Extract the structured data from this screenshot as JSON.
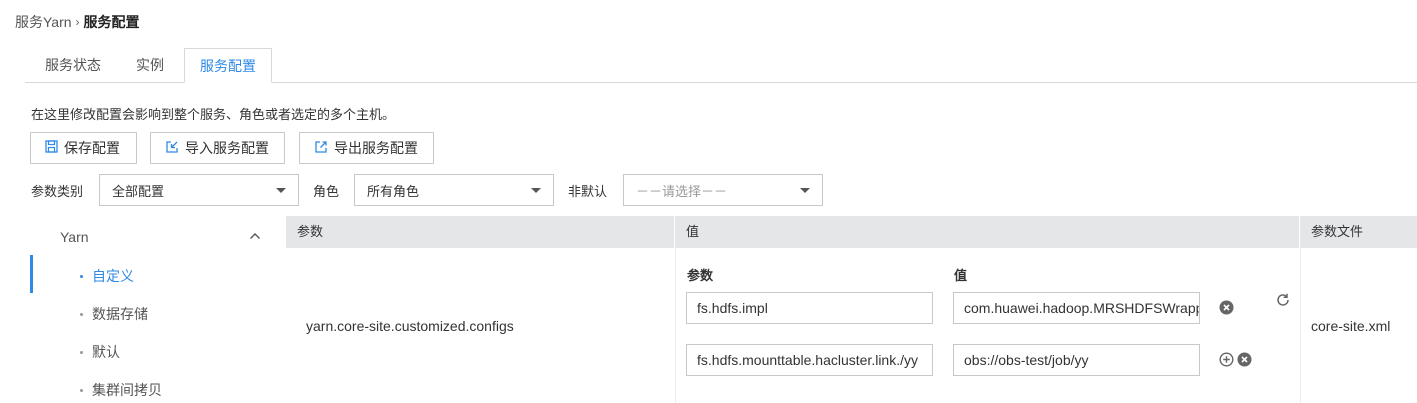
{
  "breadcrumb": {
    "parent": "服务Yarn",
    "separator": "›",
    "current": "服务配置"
  },
  "tabs": [
    {
      "label": "服务状态",
      "active": false
    },
    {
      "label": "实例",
      "active": false
    },
    {
      "label": "服务配置",
      "active": true
    }
  ],
  "description": "在这里修改配置会影响到整个服务、角色或者选定的多个主机。",
  "toolbar": {
    "save_label": "保存配置",
    "import_label": "导入服务配置",
    "export_label": "导出服务配置"
  },
  "filters": {
    "category_label": "参数类别",
    "category_value": "全部配置",
    "role_label": "角色",
    "role_value": "所有角色",
    "nondefault_label": "非默认",
    "nondefault_placeholder": "－－请选择－－"
  },
  "nav": {
    "group": "Yarn",
    "items": [
      {
        "label": "自定义",
        "active": true
      },
      {
        "label": "数据存储",
        "active": false
      },
      {
        "label": "默认",
        "active": false
      },
      {
        "label": "集群间拷贝",
        "active": false
      }
    ]
  },
  "table": {
    "headers": {
      "param": "参数",
      "value": "值",
      "file": "参数文件"
    },
    "row": {
      "name": "yarn.core-site.customized.configs",
      "sub_headers": {
        "param": "参数",
        "value": "值"
      },
      "entries": [
        {
          "param": "fs.hdfs.impl",
          "value": "com.huawei.hadoop.MRSHDFSWrapperFileSystem"
        },
        {
          "param": "fs.hdfs.mounttable.hacluster.link./yy",
          "value": "obs://obs-test/job/yy"
        }
      ],
      "file": "core-site.xml"
    }
  },
  "colors": {
    "accent": "#2e8ae6",
    "header_bg": "#e4e6e8",
    "border": "#c8c8c8"
  },
  "icons": [
    "save-icon",
    "import-icon",
    "export-icon",
    "chevron-up-icon",
    "refresh-icon",
    "remove-icon",
    "add-icon",
    "caret-down-icon"
  ]
}
